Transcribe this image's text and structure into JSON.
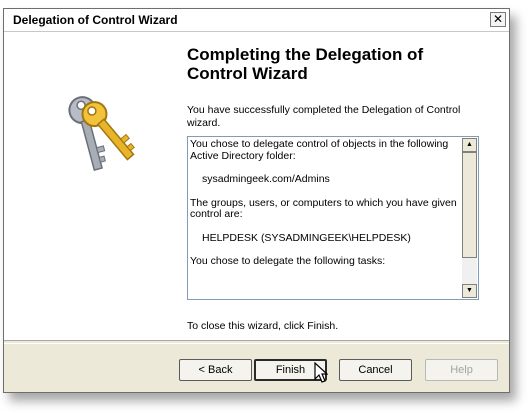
{
  "window": {
    "title": "Delegation of Control Wizard",
    "close_glyph": "✕"
  },
  "page": {
    "heading": "Completing the Delegation of Control Wizard",
    "intro": "You have successfully completed the Delegation of Control wizard.",
    "summary": {
      "line1": "You chose to delegate control of objects in the following Active Directory folder:",
      "folder": "sysadmingeek.com/Admins",
      "line2": "The groups, users, or computers to which you have given control are:",
      "group": "HELPDESK (SYSADMINGEEK\\HELPDESK)",
      "line3": "You chose to delegate the following tasks:"
    },
    "closing": "To close this wizard, click Finish."
  },
  "buttons": {
    "back": "< Back",
    "finish": "Finish",
    "cancel": "Cancel",
    "help": "Help"
  },
  "icons": {
    "art": "keys-icon",
    "scroll_up": "▲",
    "scroll_down": "▼"
  }
}
